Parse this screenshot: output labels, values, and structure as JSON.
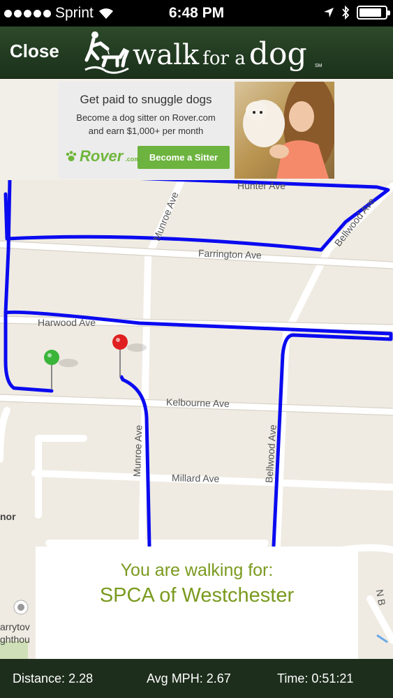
{
  "status_bar": {
    "carrier": "Sprint",
    "time": "6:48 PM",
    "battery_level": 0.85,
    "icons": [
      "signal-dots",
      "wifi-icon",
      "location-arrow-icon",
      "bluetooth-icon",
      "battery-icon"
    ]
  },
  "header": {
    "close_label": "Close",
    "logo_words": [
      "walk",
      "for a",
      "dog"
    ],
    "logo_mark": "SM",
    "background_color": "#223b21"
  },
  "ad": {
    "headline": "Get paid to snuggle dogs",
    "subline1": "Become a dog sitter on Rover.com",
    "subline2": "and earn $1,000+ per month",
    "brand": "Rover",
    "brand_suffix": ".com",
    "button_label": "Become a Sitter",
    "button_color": "#6db33f"
  },
  "map": {
    "streets": {
      "hunter": "Hunter Ave",
      "munroe_top": "Munroe Ave",
      "bellwood_top": "Bellwood Ave",
      "farrington": "Farrington Ave",
      "harwood": "Harwood Ave",
      "kelbourne": "Kelbourne Ave",
      "munroe_bottom": "Munroe Ave",
      "bellwood_bottom": "Bellwood Ave",
      "millard": "Millard Ave",
      "n_b": "N B"
    },
    "poi": {
      "nor": "nor",
      "tarrytown1": "arrytov",
      "tarrytown2": "ghthou"
    },
    "route_color": "#0a0af0",
    "start_pin_color": "#3ab53a",
    "end_pin_color": "#e02020"
  },
  "walk_card": {
    "line1": "You are walking for:",
    "line2": "SPCA of Westchester",
    "text_color": "#7a9a1e"
  },
  "stats": {
    "distance_label": "Distance:",
    "distance_value": "2.28",
    "mph_label": "Avg MPH:",
    "mph_value": "2.67",
    "time_label": "Time:",
    "time_value": "0:51:21"
  }
}
